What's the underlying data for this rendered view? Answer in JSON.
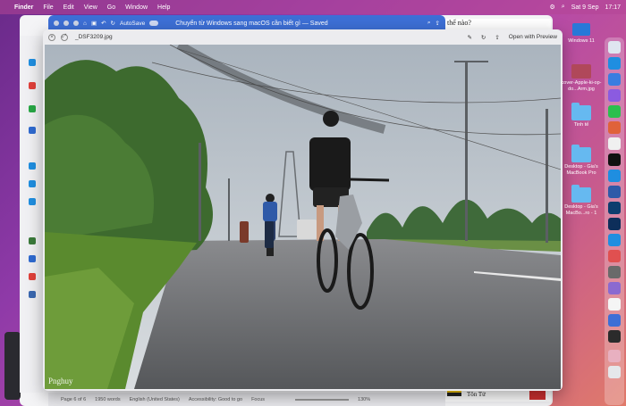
{
  "menubar": {
    "app_name": "Finder",
    "items": [
      "File",
      "Edit",
      "View",
      "Go",
      "Window",
      "Help"
    ],
    "date": "Sat 9 Sep",
    "time": "17:17"
  },
  "word": {
    "autosave_label": "AutoSave",
    "doc_title": "Chuyển từ Windows sang macOS cần biết gì — Saved",
    "doc_snippet": "thể nào?",
    "status": {
      "page": "Page 6 of 6",
      "words": "1950 words",
      "language": "English (United States)",
      "accessibility": "Accessibility: Good to go",
      "focus": "Focus",
      "zoom": "130%"
    },
    "bottom_snippet": "Tôn Tử"
  },
  "quicklook": {
    "filename": "_DSF3209.jpg",
    "open_with": "Open with Preview",
    "watermark": "Pnghuy"
  },
  "desktop": {
    "items": [
      {
        "label": "Windows 11"
      },
      {
        "label": "cover-Apple-ki-op-do...Arm.jpg"
      },
      {
        "label": "Tinh tế"
      },
      {
        "label": "Desktop - Gia's MacBook Pro"
      },
      {
        "label": "Desktop - Gia's MacBo...ro - 1"
      }
    ]
  },
  "colors": {
    "word_blue": "#3d6fd6",
    "folder_blue": "#66b9f0",
    "sky": "#c9d0d6",
    "grass": "#5a8a2e",
    "road": "#6c6d70"
  }
}
